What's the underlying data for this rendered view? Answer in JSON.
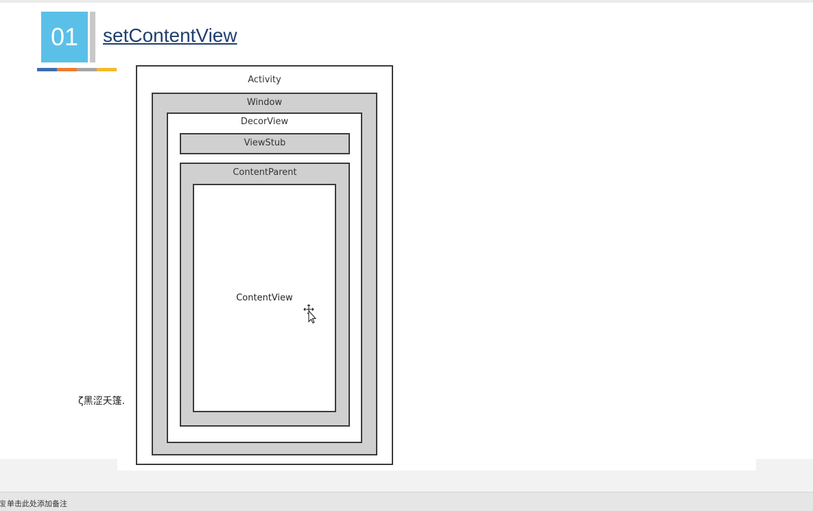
{
  "slide": {
    "number": "01",
    "title": "setContentView",
    "stray_text": "ζ黑涩夭篷.",
    "colors": {
      "badge": "#5bc0e8",
      "accent_bar": [
        "#3a6fb0",
        "#ee7d31",
        "#a5a5a5",
        "#f6b92b"
      ],
      "box_fill": "#d0d0d0"
    }
  },
  "diagram": {
    "activity": "Activity",
    "window": "Window",
    "decor_view": "DecorView",
    "view_stub": "ViewStub",
    "content_parent": "ContentParent",
    "content_view": "ContentView"
  },
  "notes": {
    "edge_char": "废",
    "placeholder": "单击此处添加备注"
  },
  "icons": {
    "cursor": "move-cursor-icon"
  }
}
